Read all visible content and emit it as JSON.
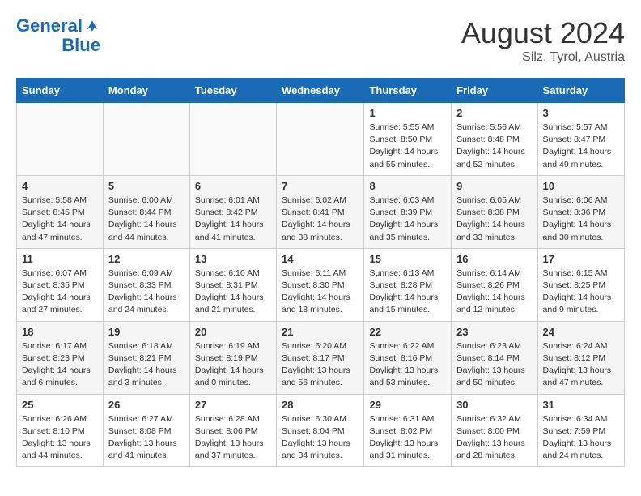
{
  "header": {
    "logo_line1": "General",
    "logo_line2": "Blue",
    "month": "August 2024",
    "location": "Silz, Tyrol, Austria"
  },
  "weekdays": [
    "Sunday",
    "Monday",
    "Tuesday",
    "Wednesday",
    "Thursday",
    "Friday",
    "Saturday"
  ],
  "weeks": [
    [
      {
        "day": "",
        "info": ""
      },
      {
        "day": "",
        "info": ""
      },
      {
        "day": "",
        "info": ""
      },
      {
        "day": "",
        "info": ""
      },
      {
        "day": "1",
        "info": "Sunrise: 5:55 AM\nSunset: 8:50 PM\nDaylight: 14 hours\nand 55 minutes."
      },
      {
        "day": "2",
        "info": "Sunrise: 5:56 AM\nSunset: 8:48 PM\nDaylight: 14 hours\nand 52 minutes."
      },
      {
        "day": "3",
        "info": "Sunrise: 5:57 AM\nSunset: 8:47 PM\nDaylight: 14 hours\nand 49 minutes."
      }
    ],
    [
      {
        "day": "4",
        "info": "Sunrise: 5:58 AM\nSunset: 8:45 PM\nDaylight: 14 hours\nand 47 minutes."
      },
      {
        "day": "5",
        "info": "Sunrise: 6:00 AM\nSunset: 8:44 PM\nDaylight: 14 hours\nand 44 minutes."
      },
      {
        "day": "6",
        "info": "Sunrise: 6:01 AM\nSunset: 8:42 PM\nDaylight: 14 hours\nand 41 minutes."
      },
      {
        "day": "7",
        "info": "Sunrise: 6:02 AM\nSunset: 8:41 PM\nDaylight: 14 hours\nand 38 minutes."
      },
      {
        "day": "8",
        "info": "Sunrise: 6:03 AM\nSunset: 8:39 PM\nDaylight: 14 hours\nand 35 minutes."
      },
      {
        "day": "9",
        "info": "Sunrise: 6:05 AM\nSunset: 8:38 PM\nDaylight: 14 hours\nand 33 minutes."
      },
      {
        "day": "10",
        "info": "Sunrise: 6:06 AM\nSunset: 8:36 PM\nDaylight: 14 hours\nand 30 minutes."
      }
    ],
    [
      {
        "day": "11",
        "info": "Sunrise: 6:07 AM\nSunset: 8:35 PM\nDaylight: 14 hours\nand 27 minutes."
      },
      {
        "day": "12",
        "info": "Sunrise: 6:09 AM\nSunset: 8:33 PM\nDaylight: 14 hours\nand 24 minutes."
      },
      {
        "day": "13",
        "info": "Sunrise: 6:10 AM\nSunset: 8:31 PM\nDaylight: 14 hours\nand 21 minutes."
      },
      {
        "day": "14",
        "info": "Sunrise: 6:11 AM\nSunset: 8:30 PM\nDaylight: 14 hours\nand 18 minutes."
      },
      {
        "day": "15",
        "info": "Sunrise: 6:13 AM\nSunset: 8:28 PM\nDaylight: 14 hours\nand 15 minutes."
      },
      {
        "day": "16",
        "info": "Sunrise: 6:14 AM\nSunset: 8:26 PM\nDaylight: 14 hours\nand 12 minutes."
      },
      {
        "day": "17",
        "info": "Sunrise: 6:15 AM\nSunset: 8:25 PM\nDaylight: 14 hours\nand 9 minutes."
      }
    ],
    [
      {
        "day": "18",
        "info": "Sunrise: 6:17 AM\nSunset: 8:23 PM\nDaylight: 14 hours\nand 6 minutes."
      },
      {
        "day": "19",
        "info": "Sunrise: 6:18 AM\nSunset: 8:21 PM\nDaylight: 14 hours\nand 3 minutes."
      },
      {
        "day": "20",
        "info": "Sunrise: 6:19 AM\nSunset: 8:19 PM\nDaylight: 14 hours and 0 minutes."
      },
      {
        "day": "21",
        "info": "Sunrise: 6:20 AM\nSunset: 8:17 PM\nDaylight: 13 hours\nand 56 minutes."
      },
      {
        "day": "22",
        "info": "Sunrise: 6:22 AM\nSunset: 8:16 PM\nDaylight: 13 hours\nand 53 minutes."
      },
      {
        "day": "23",
        "info": "Sunrise: 6:23 AM\nSunset: 8:14 PM\nDaylight: 13 hours\nand 50 minutes."
      },
      {
        "day": "24",
        "info": "Sunrise: 6:24 AM\nSunset: 8:12 PM\nDaylight: 13 hours\nand 47 minutes."
      }
    ],
    [
      {
        "day": "25",
        "info": "Sunrise: 6:26 AM\nSunset: 8:10 PM\nDaylight: 13 hours\nand 44 minutes."
      },
      {
        "day": "26",
        "info": "Sunrise: 6:27 AM\nSunset: 8:08 PM\nDaylight: 13 hours\nand 41 minutes."
      },
      {
        "day": "27",
        "info": "Sunrise: 6:28 AM\nSunset: 8:06 PM\nDaylight: 13 hours\nand 37 minutes."
      },
      {
        "day": "28",
        "info": "Sunrise: 6:30 AM\nSunset: 8:04 PM\nDaylight: 13 hours\nand 34 minutes."
      },
      {
        "day": "29",
        "info": "Sunrise: 6:31 AM\nSunset: 8:02 PM\nDaylight: 13 hours\nand 31 minutes."
      },
      {
        "day": "30",
        "info": "Sunrise: 6:32 AM\nSunset: 8:00 PM\nDaylight: 13 hours\nand 28 minutes."
      },
      {
        "day": "31",
        "info": "Sunrise: 6:34 AM\nSunset: 7:59 PM\nDaylight: 13 hours\nand 24 minutes."
      }
    ]
  ]
}
